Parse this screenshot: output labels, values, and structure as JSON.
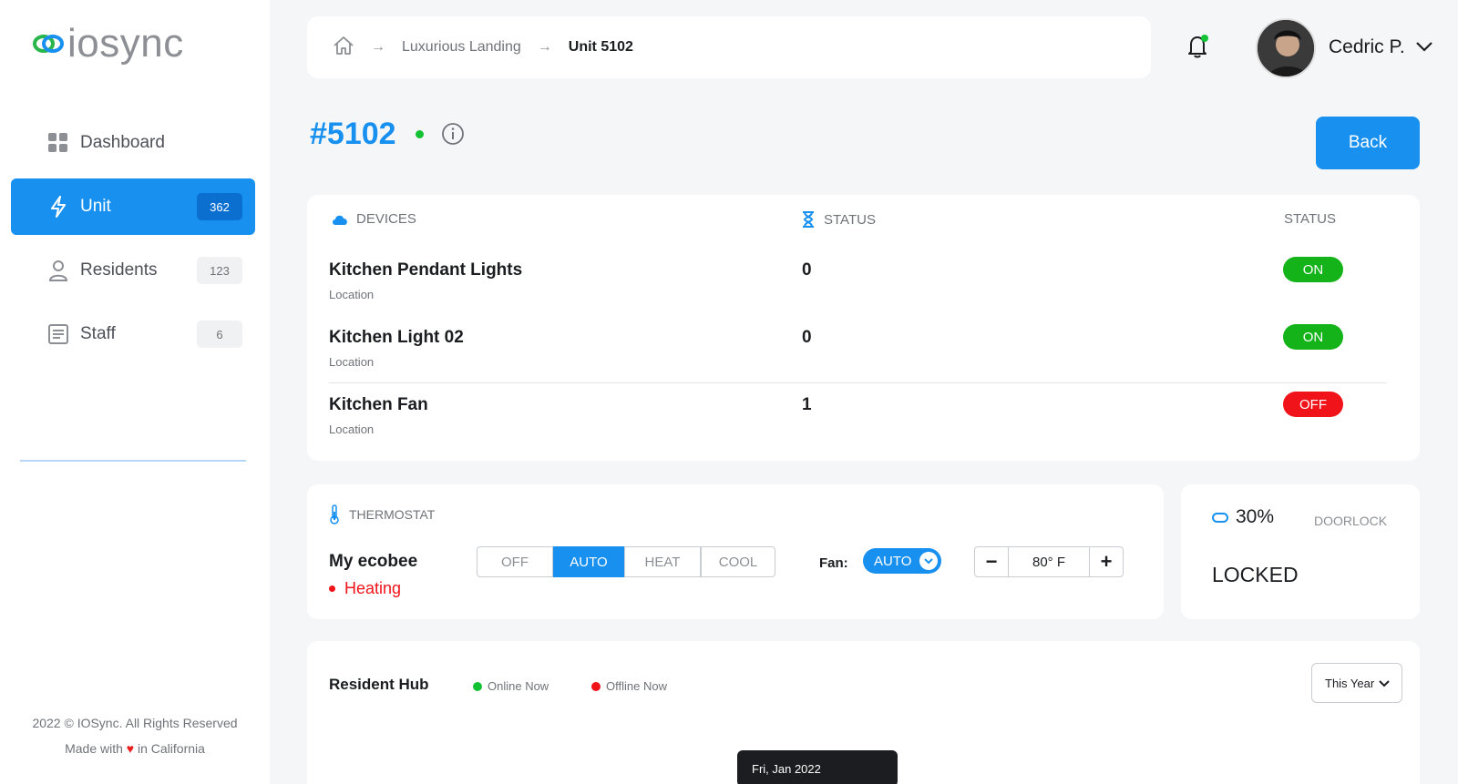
{
  "brand": {
    "name": "iosync"
  },
  "sidebar": {
    "items": [
      {
        "label": "Dashboard",
        "badge": ""
      },
      {
        "label": "Unit",
        "badge": "362"
      },
      {
        "label": "Residents",
        "badge": "123"
      },
      {
        "label": "Staff",
        "badge": "6"
      }
    ],
    "footer": {
      "copyright": "2022 © IOSync. All Rights Reserved",
      "made_prefix": "Made with",
      "made_suffix": "in California"
    }
  },
  "header": {
    "breadcrumb": [
      "Luxurious Landing",
      "Unit 5102"
    ],
    "user": {
      "name": "Cedric P."
    }
  },
  "unit": {
    "title": "#5102",
    "back_label": "Back"
  },
  "devices": {
    "headers": {
      "devices": "DEVICES",
      "status": "STATUS",
      "status2": "STATUS"
    },
    "rows": [
      {
        "name": "Kitchen Pendant Lights",
        "location": "Location",
        "value": "0",
        "state": "ON"
      },
      {
        "name": "Kitchen Light 02",
        "location": "Location",
        "value": "0",
        "state": "ON"
      },
      {
        "name": "Kitchen Fan",
        "location": "Location",
        "value": "1",
        "state": "OFF"
      }
    ]
  },
  "thermostat": {
    "heading": "THERMOSTAT",
    "name": "My ecobee",
    "state": "Heating",
    "modes": [
      "OFF",
      "AUTO",
      "HEAT",
      "COOL"
    ],
    "active_mode": "AUTO",
    "fan_label": "Fan:",
    "fan_value": "AUTO",
    "temperature": "80° F",
    "minus": "−",
    "plus": "+"
  },
  "doorlock": {
    "battery": "30%",
    "heading": "DOORLOCK",
    "state": "LOCKED"
  },
  "hub": {
    "title": "Resident Hub",
    "legend_online": "Online Now",
    "legend_offline": "Offline Now",
    "period": "This Year",
    "tooltip": "Fri, Jan 2022"
  },
  "colors": {
    "accent": "#1890f0",
    "on": "#14b319",
    "off": "#f0131a",
    "online": "#12c234"
  }
}
